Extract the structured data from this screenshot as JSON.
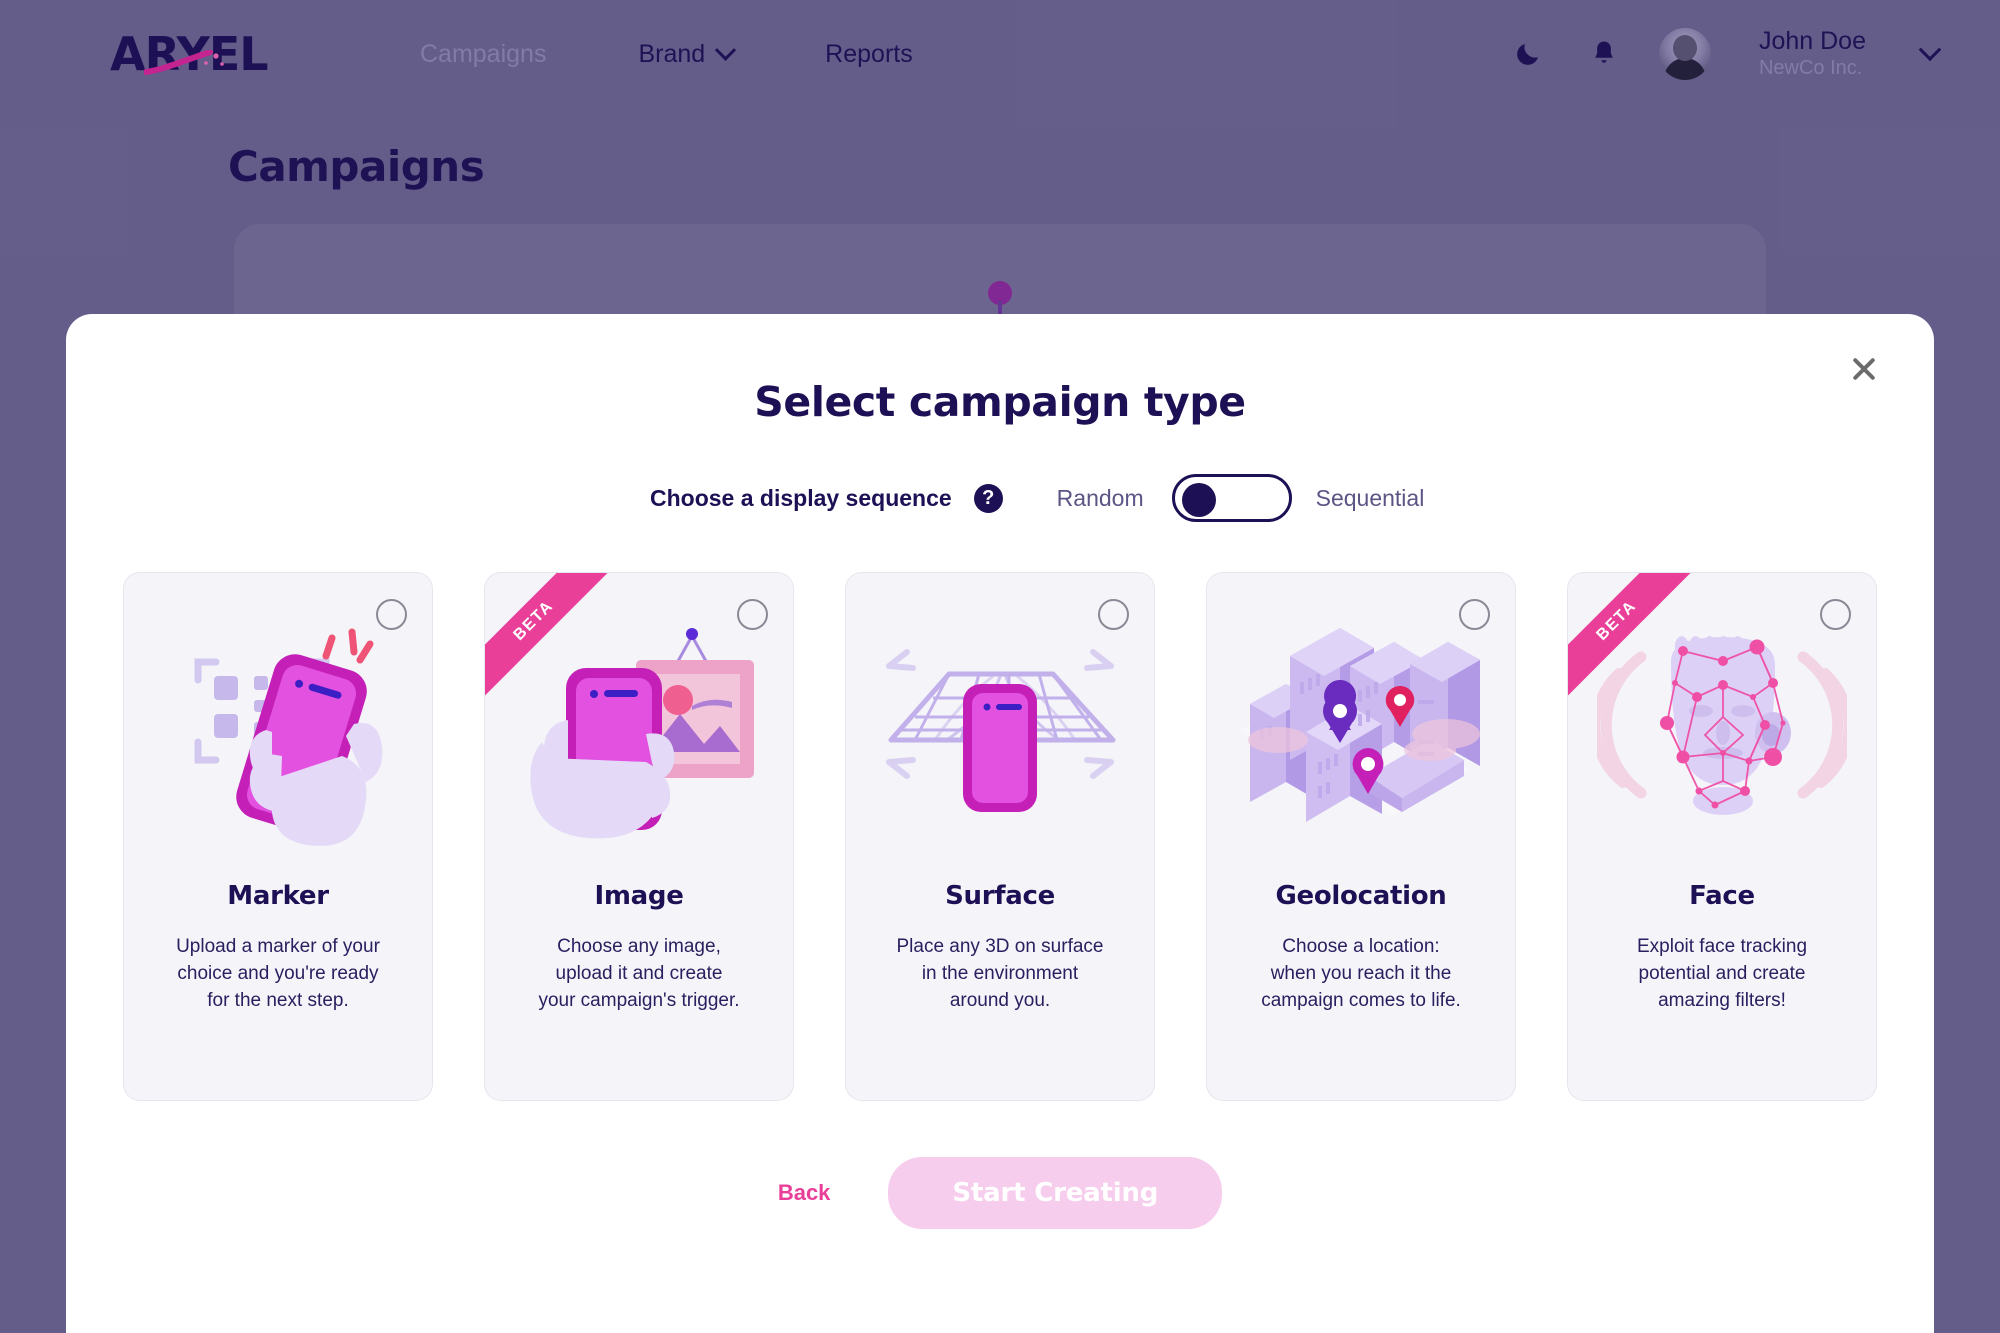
{
  "brand": {
    "logo_text": "ARYEL"
  },
  "topnav": {
    "items": [
      {
        "label": "Campaigns",
        "active": false
      },
      {
        "label": "Brand",
        "has_dropdown": true
      },
      {
        "label": "Reports",
        "has_dropdown": false
      }
    ],
    "dark_mode_icon": "moon-icon",
    "notifications_icon": "bell-icon",
    "user": {
      "name": "John Doe",
      "org": "NewCo Inc.",
      "avatar_icon": "user-avatar"
    }
  },
  "page": {
    "title": "Campaigns"
  },
  "modal": {
    "title": "Select campaign type",
    "close_icon": "close-icon",
    "sequence": {
      "label": "Choose a display sequence",
      "help_icon": "question-mark-icon",
      "option_left": "Random",
      "option_right": "Sequential",
      "selected": "Random"
    },
    "cards": [
      {
        "id": "marker",
        "title": "Marker",
        "desc": "Upload a marker of your\nchoice and you're ready\nfor the next step.",
        "badge": null,
        "selected": false,
        "art_icon": "hand-phone-marker-icon"
      },
      {
        "id": "image",
        "title": "Image",
        "desc": "Choose any image,\nupload it and create\nyour campaign's trigger.",
        "badge": "BETA",
        "selected": false,
        "art_icon": "hand-phone-picture-icon"
      },
      {
        "id": "surface",
        "title": "Surface",
        "desc": "Place any 3D on surface\nin the environment\naround you.",
        "badge": null,
        "selected": false,
        "art_icon": "phone-grid-plane-icon"
      },
      {
        "id": "geolocation",
        "title": "Geolocation",
        "desc": "Choose a location:\nwhen you reach it the\ncampaign comes to life.",
        "badge": null,
        "selected": false,
        "art_icon": "city-map-pins-icon"
      },
      {
        "id": "face",
        "title": "Face",
        "desc": "Exploit face tracking\npotential and create\namazing filters!",
        "badge": "BETA",
        "selected": false,
        "art_icon": "face-mesh-icon"
      }
    ],
    "footer": {
      "back_label": "Back",
      "start_label": "Start Creating",
      "start_disabled": true
    }
  },
  "colors": {
    "overlay": "#6d6692",
    "brand_dark": "#1e1055",
    "accent_pink": "#ea3f98",
    "magenta": "#c420b8",
    "card_bg": "#f4f4f9",
    "disabled_pink": "#f7cdee"
  }
}
